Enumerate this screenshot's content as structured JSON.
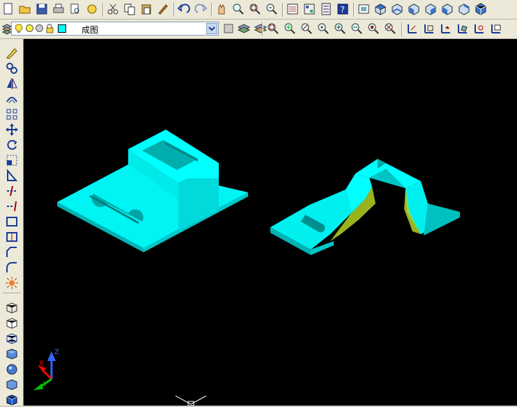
{
  "layer_control": {
    "current_layer": "成图"
  },
  "ucs_axes": {
    "x_label": "X",
    "y_label": "Y",
    "z_label": "Z"
  },
  "colors": {
    "model_face_light": "#00ffff",
    "model_face_mid": "#00d8d8",
    "model_face_dark": "#00b0b0",
    "section_hatch": "#b4d224",
    "axis_x": "#ff0000",
    "axis_y": "#00c000",
    "axis_z": "#3264ff"
  },
  "toolbar_top": [
    "new-icon",
    "open-icon",
    "save-icon",
    "print-icon",
    "print-preview-icon",
    "publish-icon",
    "cut-icon",
    "copy-icon",
    "paste-icon",
    "match-properties-icon",
    "undo-icon",
    "redo-icon",
    "pan-icon",
    "zoom-realtime-icon",
    "zoom-window-icon",
    "zoom-previous-icon",
    "properties-icon",
    "design-center-icon",
    "tool-palettes-icon",
    "help-icon",
    "named-views-icon",
    "top-view-icon",
    "bottom-view-icon",
    "left-view-icon",
    "right-view-icon",
    "front-view-icon",
    "back-view-icon",
    "iso-view-icon"
  ],
  "toolbar_second": [
    "layer-manager-icon",
    "make-current-icon",
    "layer-previous-icon",
    "zoom-window-icon",
    "zoom-dynamic-icon",
    "zoom-scale-icon",
    "zoom-center-icon",
    "zoom-in-icon",
    "zoom-out-icon",
    "zoom-all-icon",
    "zoom-extents-icon",
    "ucs-icon",
    "ucs-world-icon",
    "ucs-previous-icon",
    "ucs-face-icon",
    "ucs-object-icon",
    "ucs-view-icon"
  ],
  "toolbar_left": [
    "erase-icon",
    "copy-object-icon",
    "mirror-icon",
    "offset-icon",
    "array-icon",
    "move-icon",
    "rotate-icon",
    "scale-icon",
    "stretch-icon",
    "trim-icon",
    "extend-icon",
    "break-icon",
    "join-icon",
    "chamfer-icon",
    "fillet-icon",
    "explode-icon",
    "3d-view-icon",
    "hide-icon",
    "3d-wireframe-icon",
    "shaded-icon",
    "realistic-icon",
    "flat-shade-icon",
    "3d-box-icon"
  ]
}
